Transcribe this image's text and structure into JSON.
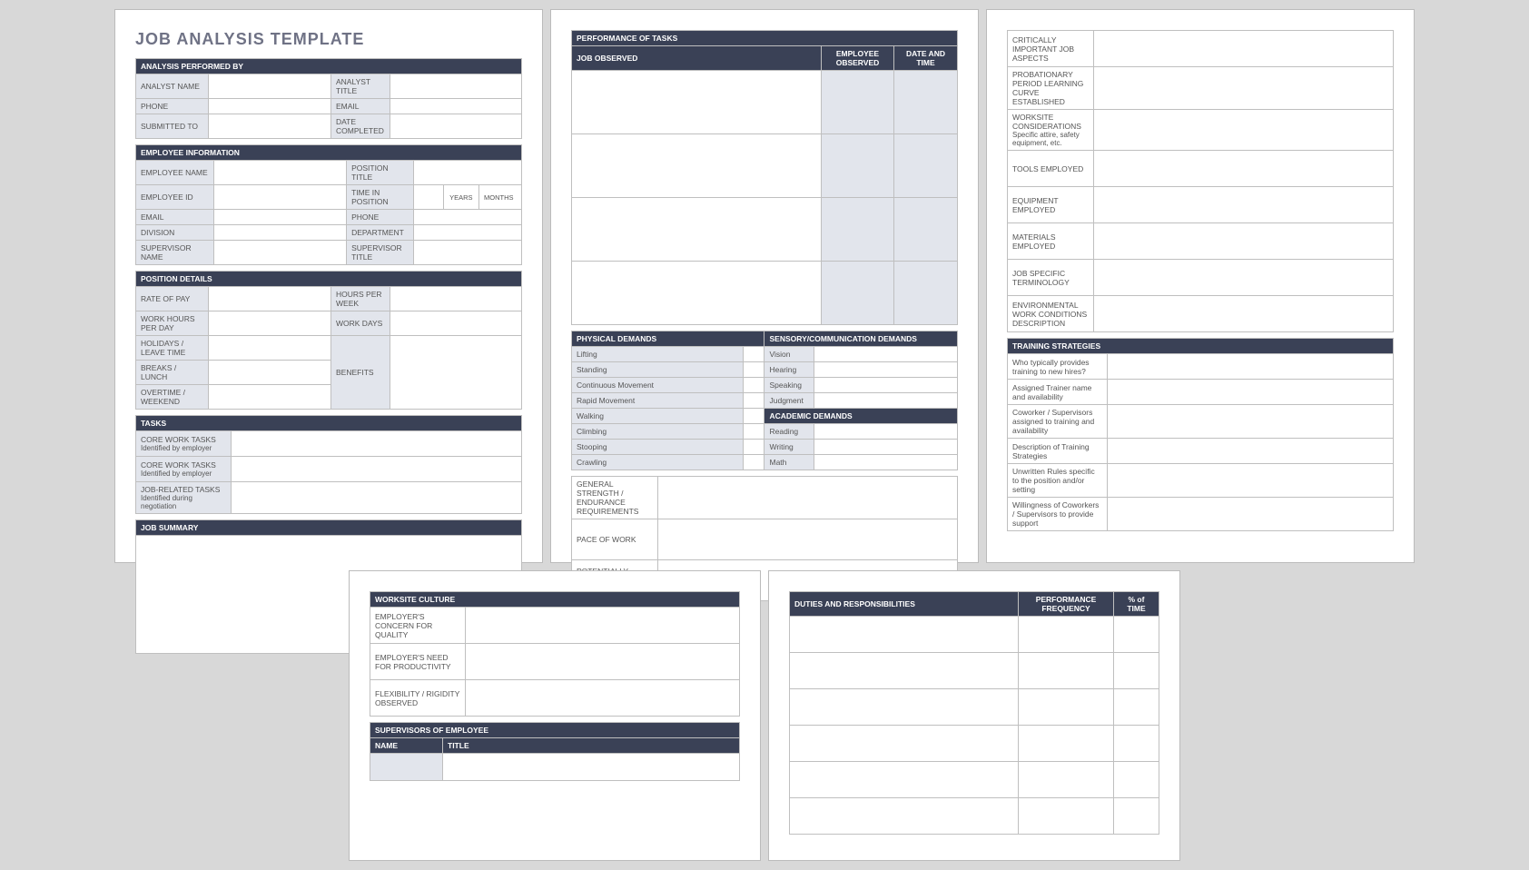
{
  "title": "JOB ANALYSIS TEMPLATE",
  "sec": {
    "analysis_by": "ANALYSIS PERFORMED BY",
    "emp_info": "EMPLOYEE INFORMATION",
    "pos_details": "POSITION DETAILS",
    "tasks": "TASKS",
    "job_summary": "JOB SUMMARY",
    "perf_tasks": "PERFORMANCE OF TASKS",
    "phys": "PHYSICAL DEMANDS",
    "sensory": "SENSORY/COMMUNICATION DEMANDS",
    "academic": "ACADEMIC DEMANDS",
    "training": "TRAINING STRATEGIES",
    "worksite": "WORKSITE CULTURE",
    "supervisors": "SUPERVISORS OF EMPLOYEE",
    "duties": "DUTIES AND RESPONSIBILITIES"
  },
  "fields": {
    "analyst_name": "ANALYST NAME",
    "analyst_title": "ANALYST TITLE",
    "phone": "PHONE",
    "email": "EMAIL",
    "submitted_to": "SUBMITTED TO",
    "date_completed": "DATE COMPLETED",
    "emp_name": "EMPLOYEE NAME",
    "position_title": "POSITION TITLE",
    "emp_id": "EMPLOYEE ID",
    "time_in_pos": "TIME IN POSITION",
    "years": "YEARS",
    "months": "MONTHS",
    "division": "DIVISION",
    "department": "DEPARTMENT",
    "supervisor_name": "SUPERVISOR NAME",
    "supervisor_title": "SUPERVISOR TITLE",
    "rate_of_pay": "RATE OF PAY",
    "hours_per_week": "HOURS PER WEEK",
    "work_hours_per_day": "WORK HOURS PER DAY",
    "work_days": "WORK DAYS",
    "holidays": "HOLIDAYS / LEAVE TIME",
    "breaks": "BREAKS / LUNCH",
    "overtime": "OVERTIME / WEEKEND",
    "benefits": "BENEFITS",
    "core_tasks_1": "CORE WORK TASKS",
    "core_tasks_1_sub": "Identified by employer",
    "core_tasks_2": "CORE WORK TASKS",
    "core_tasks_2_sub": "Identified by employer",
    "job_related": "JOB-RELATED TASKS",
    "job_related_sub": "Identified during negotiation",
    "job_observed": "JOB OBSERVED",
    "emp_observed": "EMPLOYEE OBSERVED",
    "date_time": "DATE AND TIME",
    "lifting": "Lifting",
    "standing": "Standing",
    "contmove": "Continuous Movement",
    "rapid": "Rapid Movement",
    "walking": "Walking",
    "climbing": "Climbing",
    "stooping": "Stooping",
    "crawling": "Crawling",
    "vision": "Vision",
    "hearing": "Hearing",
    "speaking": "Speaking",
    "judgment": "Judgment",
    "reading": "Reading",
    "writing": "Writing",
    "math": "Math",
    "strength": "GENERAL STRENGTH / ENDURANCE REQUIREMENTS",
    "pace": "PACE OF WORK",
    "dangerous": "POTENTIALLY DANGEROUS JOB ASPECTS",
    "crit_important": "CRITICALLY IMPORTANT JOB ASPECTS",
    "probation": "PROBATIONARY PERIOD LEARNING CURVE ESTABLISHED",
    "worksite_consid": "WORKSITE CONSIDERATIONS",
    "worksite_sub": "Specific attire, safety equipment, etc.",
    "tools": "TOOLS EMPLOYED",
    "equipment": "EQUIPMENT EMPLOYED",
    "materials": "MATERIALS EMPLOYED",
    "terminology": "JOB SPECIFIC TERMINOLOGY",
    "env_work": "ENVIRONMENTAL WORK CONDITIONS DESCRIPTION",
    "who_trains": "Who typically provides training to new hires?",
    "assigned_trainer": "Assigned Trainer name and availability",
    "coworker_sup": "Coworker / Supervisors assigned to training and availability",
    "desc_training": "Description of Training Strategies",
    "unwritten": "Unwritten Rules specific to the position and/or setting",
    "willingness": "Willingness of Coworkers / Supervisors to provide support",
    "concern_quality": "EMPLOYER'S CONCERN FOR QUALITY",
    "need_prod": "EMPLOYER'S NEED FOR PRODUCTIVITY",
    "flex_rigid": "FLEXIBILITY / RIGIDITY OBSERVED",
    "name": "NAME",
    "title_col": "TITLE",
    "perf_freq": "PERFORMANCE FREQUENCY",
    "pct_time": "% of TIME"
  }
}
